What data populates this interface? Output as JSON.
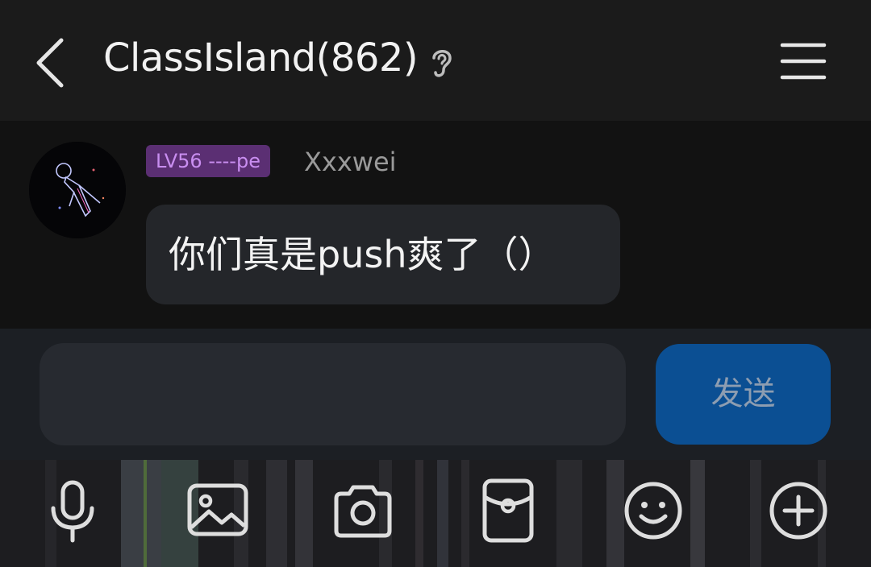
{
  "header": {
    "title": "ClassIsland(862)",
    "back_icon": "chevron-left-icon",
    "listen_icon": "ear-icon",
    "menu_icon": "menu-icon"
  },
  "message": {
    "level_badge": "LV56 ----pe",
    "sender": "Xxxwei",
    "text": "你们真是push爽了（）"
  },
  "composer": {
    "input_value": "",
    "send_label": "发送"
  },
  "toolbar": {
    "items": [
      "microphone-icon",
      "image-icon",
      "camera-icon",
      "red-packet-icon",
      "emoji-icon",
      "plus-icon"
    ]
  },
  "colors": {
    "background": "#151515",
    "badge_bg": "#5b2f73",
    "badge_text": "#c98ef0",
    "send_bg": "#0b4f93",
    "bubble_bg": "#24262a"
  }
}
